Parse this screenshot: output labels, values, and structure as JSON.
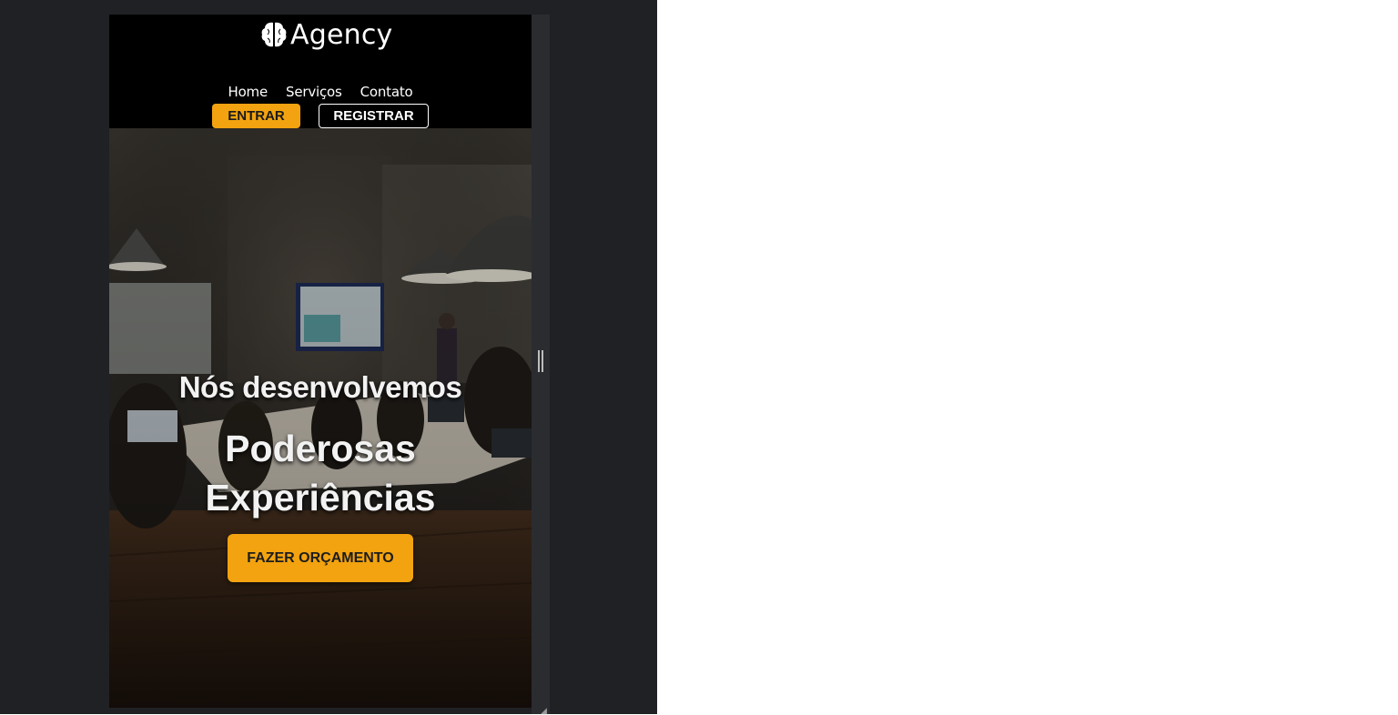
{
  "header": {
    "logo_text": "Agency",
    "nav": [
      "Home",
      "Serviços",
      "Contato"
    ],
    "login_label": "ENTRAR",
    "register_label": "REGISTRAR"
  },
  "hero": {
    "line1": "Nós desenvolvemos",
    "line2": "Poderosas",
    "line3": "Experiências",
    "cta_label": "FAZER ORÇAMENTO"
  },
  "colors": {
    "accent": "#f2a30f",
    "header_bg": "#000000",
    "devtools_bg": "#202124"
  },
  "icons": {
    "logo": "brain-icon"
  }
}
